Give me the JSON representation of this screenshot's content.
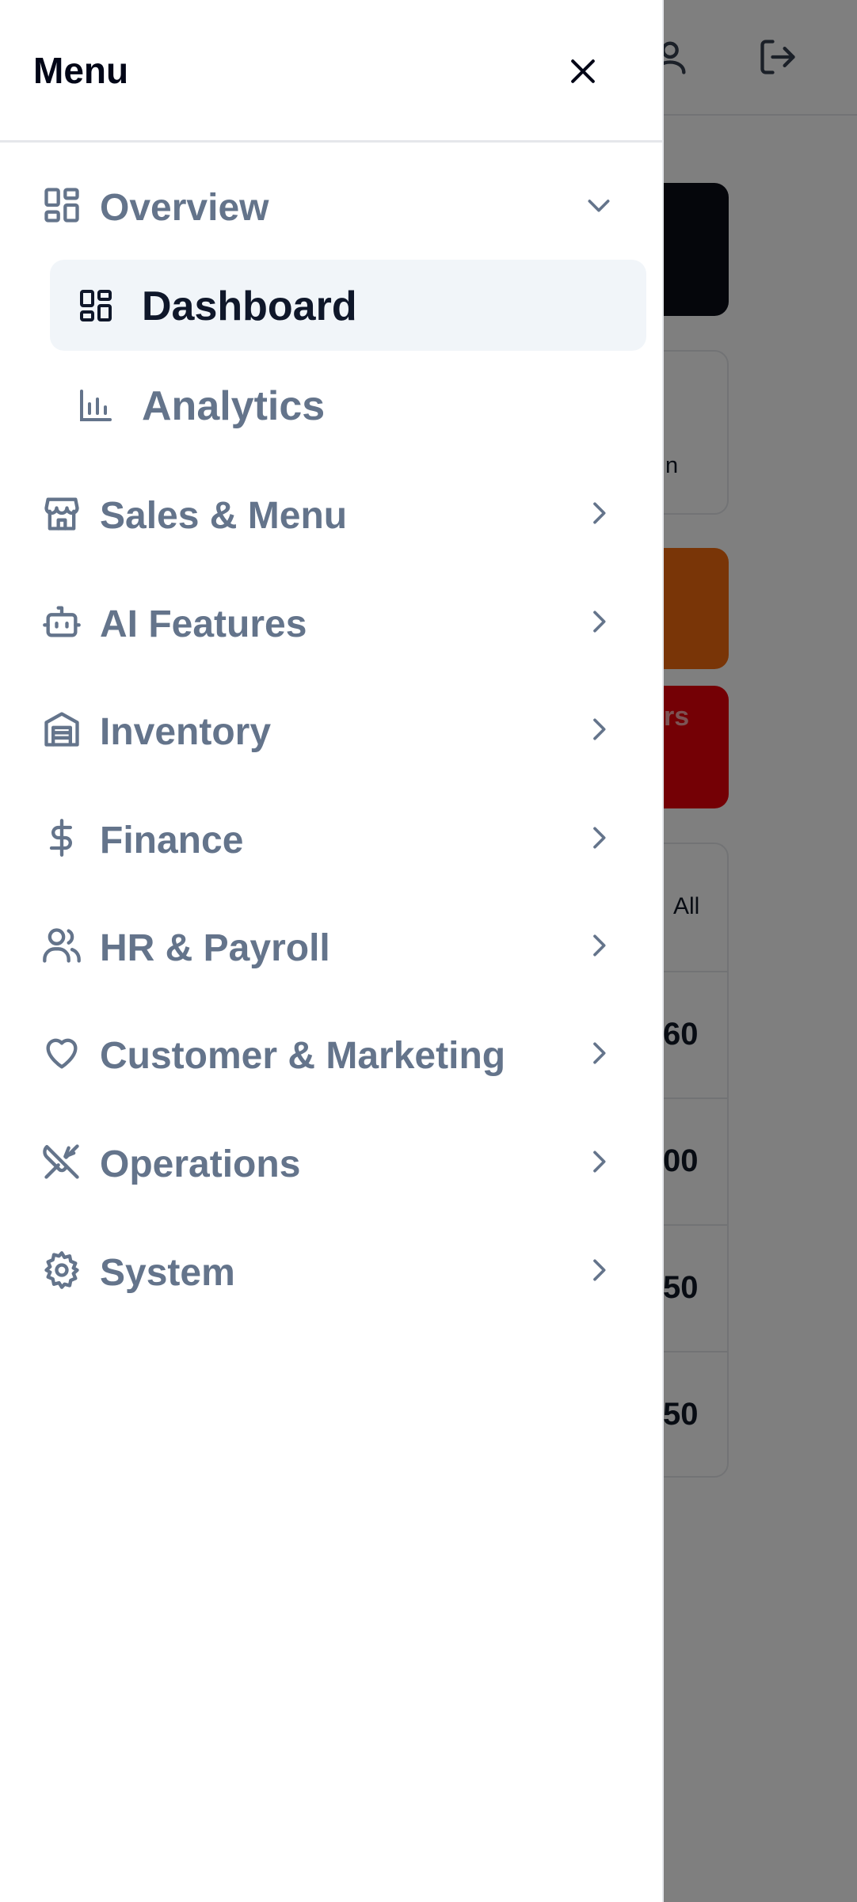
{
  "background": {
    "card_text": "n",
    "alert_text": "rs",
    "table_header": "All",
    "table_values": [
      "60",
      "00",
      "50",
      "50"
    ]
  },
  "drawer": {
    "title": "Menu",
    "close_icon": "close-icon",
    "sections": [
      {
        "label": "Overview",
        "icon": "layout-grid-icon",
        "expanded": true,
        "children": [
          {
            "label": "Dashboard",
            "icon": "dashboard-icon",
            "active": true
          },
          {
            "label": "Analytics",
            "icon": "bar-chart-icon",
            "active": false
          }
        ]
      },
      {
        "label": "Sales & Menu",
        "icon": "store-icon",
        "expanded": false
      },
      {
        "label": "AI Features",
        "icon": "bot-icon",
        "expanded": false
      },
      {
        "label": "Inventory",
        "icon": "warehouse-icon",
        "expanded": false
      },
      {
        "label": "Finance",
        "icon": "dollar-icon",
        "expanded": false
      },
      {
        "label": "HR & Payroll",
        "icon": "users-icon",
        "expanded": false
      },
      {
        "label": "Customer & Marketing",
        "icon": "heart-icon",
        "expanded": false
      },
      {
        "label": "Operations",
        "icon": "utensils-crossed-icon",
        "expanded": false
      },
      {
        "label": "System",
        "icon": "settings-icon",
        "expanded": false
      }
    ]
  },
  "colors": {
    "overlay": "rgba(0,0,0,0.5)",
    "nav_text": "#64748b",
    "active_bg": "#f1f5f9",
    "active_text": "#0f172a"
  }
}
